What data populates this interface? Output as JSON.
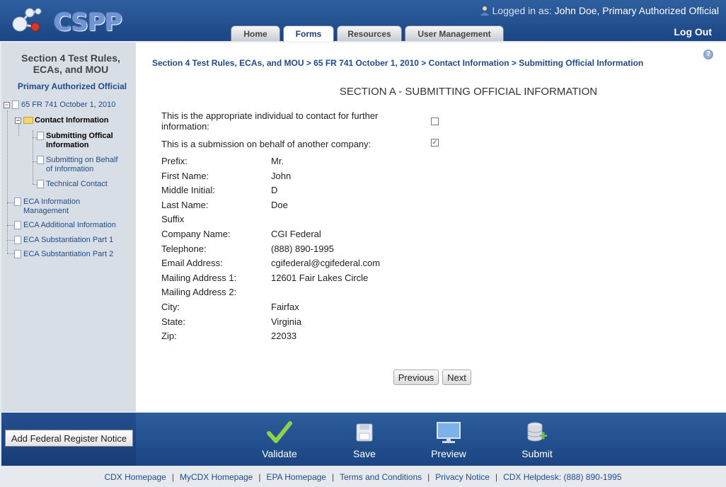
{
  "header": {
    "logo_text": "CSPP",
    "login_prefix": "Logged in as:",
    "login_user": "John Doe, Primary Authorized Official",
    "logout": "Log Out",
    "tabs": [
      {
        "label": "Home"
      },
      {
        "label": "Forms",
        "active": true
      },
      {
        "label": "Resources"
      },
      {
        "label": "User Management"
      }
    ]
  },
  "sidebar": {
    "title_line1": "Section 4 Test Rules,",
    "title_line2": "ECAs, and MOU",
    "role": "Primary Authorized Official",
    "tree": {
      "root": "65 FR 741 October 1, 2010",
      "contact_info": "Contact Information",
      "submitting_official": "Submitting Offical Information",
      "submitting_behalf": "Submitting on Behalf of Information",
      "technical_contact": "Technical Contact",
      "eca_info_mgmt": "ECA Information Management",
      "eca_additional": "ECA Additional Information",
      "eca_sub1": "ECA Substantiation Part 1",
      "eca_sub2": "ECA Substantiation Part 2"
    }
  },
  "main": {
    "breadcrumb": "Section 4 Test Rules, ECAs, and MOU > 65 FR 741 October 1, 2010 > Contact Information > Submitting Official Information",
    "section_title": "SECTION A - SUBMITTING OFFICIAL INFORMATION",
    "q1": "This is the appropriate individual to contact for further information:",
    "q1_checked": false,
    "q2": "This is a submission on behalf of another company:",
    "q2_checked": true,
    "check_mark": "✓",
    "fields": [
      {
        "label": "Prefix:",
        "value": "Mr."
      },
      {
        "label": "First Name:",
        "value": "John"
      },
      {
        "label": "Middle Initial:",
        "value": "D"
      },
      {
        "label": "Last Name:",
        "value": "Doe"
      },
      {
        "label": "Suffix",
        "value": ""
      },
      {
        "label": "Company Name:",
        "value": "CGI Federal"
      },
      {
        "label": "Telephone:",
        "value": "(888) 890-1995"
      },
      {
        "label": "Email Address:",
        "value": "cgifederal@cgifederal.com"
      },
      {
        "label": "Mailing Address 1:",
        "value": "12601 Fair Lakes Circle"
      },
      {
        "label": "Mailing Address 2:",
        "value": ""
      },
      {
        "label": "City:",
        "value": "Fairfax"
      },
      {
        "label": "State:",
        "value": "Virginia"
      },
      {
        "label": "Zip:",
        "value": "22033"
      }
    ],
    "previous": "Previous",
    "next": "Next"
  },
  "footer": {
    "add_fr_notice": "Add Federal Register Notice",
    "actions": {
      "validate": "Validate",
      "save": "Save",
      "preview": "Preview",
      "submit": "Submit"
    },
    "links": [
      "CDX Homepage",
      "MyCDX Homepage",
      "EPA Homepage",
      "Terms and Conditions",
      "Privacy Notice",
      "CDX Helpdesk: (888) 890-1995"
    ]
  },
  "colors": {
    "header_blue": "#1b4583",
    "link_blue": "#1f4b8a",
    "check_green": "#2a8a2a"
  }
}
